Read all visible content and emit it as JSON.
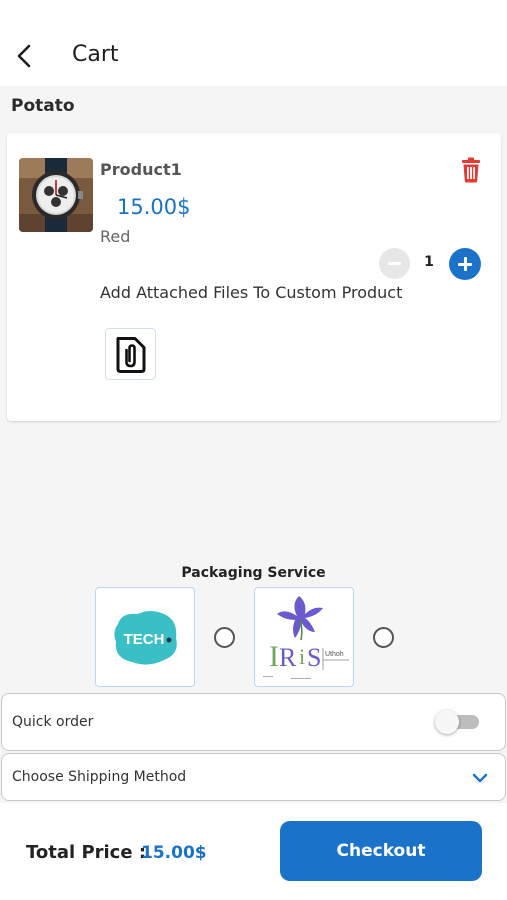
{
  "appbar": {
    "title": "Cart",
    "back_icon": "chevron-left-icon"
  },
  "store": {
    "name": "Potato"
  },
  "cart_item": {
    "name": "Product1",
    "price": "15.00$",
    "variant": "Red",
    "quantity": "1",
    "delete_icon": "trash-icon",
    "attach_label": "Add Attached Files To Custom Product",
    "attach_icon": "paperclip-file-icon"
  },
  "packaging": {
    "title": "Packaging Service",
    "options": [
      {
        "logo_text": "TECH",
        "selected": false
      },
      {
        "logo_text": "IRIS",
        "selected": false
      }
    ]
  },
  "quick_order": {
    "label": "Quick order",
    "enabled": false
  },
  "shipping": {
    "label": "Choose Shipping Method",
    "icon": "chevron-down-icon"
  },
  "footer": {
    "total_label": "Total Price :",
    "total_value": "15.00$",
    "checkout_label": "Checkout"
  },
  "colors": {
    "accent": "#1a73c8",
    "danger": "#e53935",
    "background": "#f5f5f5",
    "tech_logo": "#3bbfc7",
    "iris_flower": "#6a5acd"
  }
}
